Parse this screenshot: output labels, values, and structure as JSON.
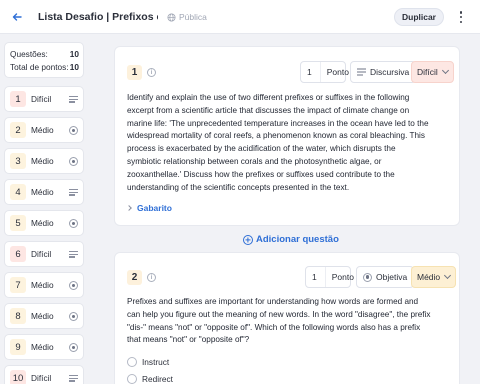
{
  "header": {
    "back_icon": "arrow-left-icon",
    "title": "Lista Desafio | Prefixos e Sufixos",
    "visibility": "Pública",
    "duplicate_label": "Duplicar",
    "accent": "#2f6fd6"
  },
  "stats": {
    "questions_label": "Questões:",
    "questions_value": "10",
    "points_label": "Total de pontos:",
    "points_value": "10"
  },
  "sidebar": {
    "items": [
      {
        "num": "1",
        "difficulty": "Difícil",
        "type_icon": "lines-icon"
      },
      {
        "num": "2",
        "difficulty": "Médio",
        "type_icon": "radio-icon"
      },
      {
        "num": "3",
        "difficulty": "Médio",
        "type_icon": "radio-icon"
      },
      {
        "num": "4",
        "difficulty": "Médio",
        "type_icon": "lines-icon"
      },
      {
        "num": "5",
        "difficulty": "Médio",
        "type_icon": "radio-icon"
      },
      {
        "num": "6",
        "difficulty": "Difícil",
        "type_icon": "lines-icon"
      },
      {
        "num": "7",
        "difficulty": "Médio",
        "type_icon": "radio-icon"
      },
      {
        "num": "8",
        "difficulty": "Médio",
        "type_icon": "radio-icon"
      },
      {
        "num": "9",
        "difficulty": "Médio",
        "type_icon": "radio-icon"
      },
      {
        "num": "10",
        "difficulty": "Difícil",
        "type_icon": "lines-icon"
      }
    ]
  },
  "q1": {
    "num": "1",
    "points_value": "1",
    "points_label": "Ponto",
    "type": "Discursiva",
    "difficulty": "Difícil",
    "lines": [
      "Identify and explain the use of two different prefixes or suffixes in the following",
      "excerpt from a scientific article that discusses the impact of climate change on",
      "marine life: 'The unprecedented temperature increases in the ocean have led to the",
      "widespread mortality of coral reefs, a phenomenon known as coral bleaching. This",
      "process is exacerbated by the acidification of the water, which disrupts the",
      "symbiotic relationship between corals and the photosynthetic algae, or",
      "zooxanthellae.' Discuss how the prefixes or suffixes used contribute to the",
      "understanding of the scientific concepts presented in the text."
    ],
    "answer_label": "Gabarito"
  },
  "add_question": "Adicionar questão",
  "q2": {
    "num": "2",
    "points_value": "1",
    "points_label": "Ponto",
    "type": "Objetiva",
    "difficulty": "Médio",
    "lines": [
      "Prefixes and suffixes are important for understanding how words are formed and",
      "can help you figure out the meaning of new words. In the word \"disagree\", the prefix",
      "\"dis-\" means \"not\" or \"opposite of\". Which of the following words also has a prefix",
      "that means \"not\" or \"opposite of\"?"
    ],
    "options": [
      "Instruct",
      "Redirect"
    ]
  }
}
